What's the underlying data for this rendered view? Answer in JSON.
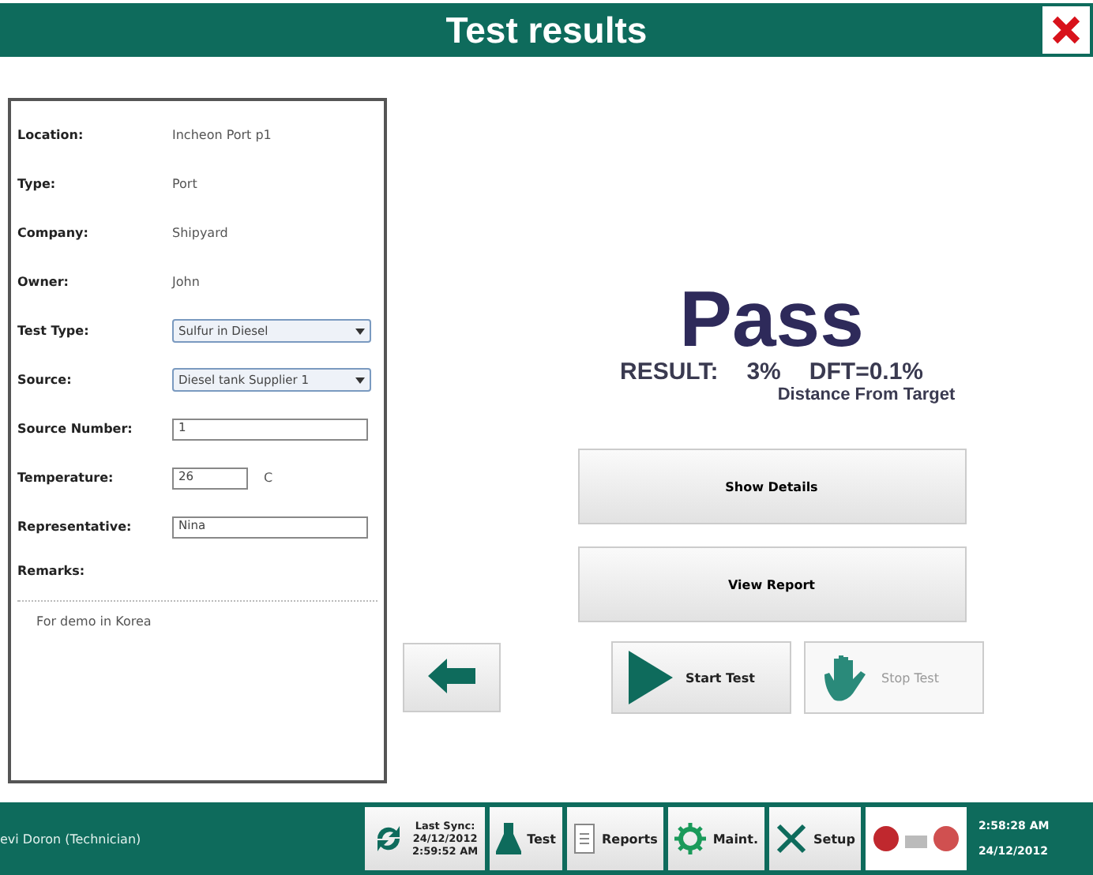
{
  "window": {
    "title": "Test results"
  },
  "details": [
    {
      "label": "Location:",
      "kind": "text",
      "value": "Incheon Port p1"
    },
    {
      "label": "Type:",
      "kind": "text",
      "value": "Port"
    },
    {
      "label": "Company:",
      "kind": "text",
      "value": "Shipyard"
    },
    {
      "label": "Owner:",
      "kind": "text",
      "value": "John"
    },
    {
      "label": "Test Type:",
      "kind": "select",
      "value": "Sulfur in Diesel"
    },
    {
      "label": "Source:",
      "kind": "select",
      "value": "Diesel tank Supplier 1"
    },
    {
      "label": "Source Number:",
      "kind": "input",
      "value": "1"
    },
    {
      "label": "Temperature:",
      "kind": "short",
      "value": "26",
      "unit": "C"
    },
    {
      "label": "Representative:",
      "kind": "input",
      "value": "Nina"
    }
  ],
  "remarks": {
    "label": "Remarks:",
    "value": "For demo in Korea"
  },
  "result": {
    "verdict": "Pass",
    "label": "RESULT:",
    "value": "3%",
    "dft": "DFT=0.1%",
    "dft_caption": "Distance From Target"
  },
  "actions": [
    "Show Details",
    "View Report"
  ],
  "test_buttons": [
    {
      "kind": "start",
      "label": "Start Test",
      "disabled": false
    },
    {
      "kind": "stop",
      "label": "Stop Test",
      "disabled": true
    }
  ],
  "status_bar": {
    "user": "evi Doron (Technician)",
    "sync": [
      "Last Sync:",
      "24/12/2012",
      "2:59:52 AM"
    ],
    "tabs": [
      {
        "kind": "test",
        "label": "Test"
      },
      {
        "kind": "reports",
        "label": "Reports"
      },
      {
        "kind": "maint",
        "label": "Maint."
      },
      {
        "kind": "setup",
        "label": "Setup"
      }
    ],
    "time": "2:58:28 AM",
    "date": "24/12/2012"
  }
}
